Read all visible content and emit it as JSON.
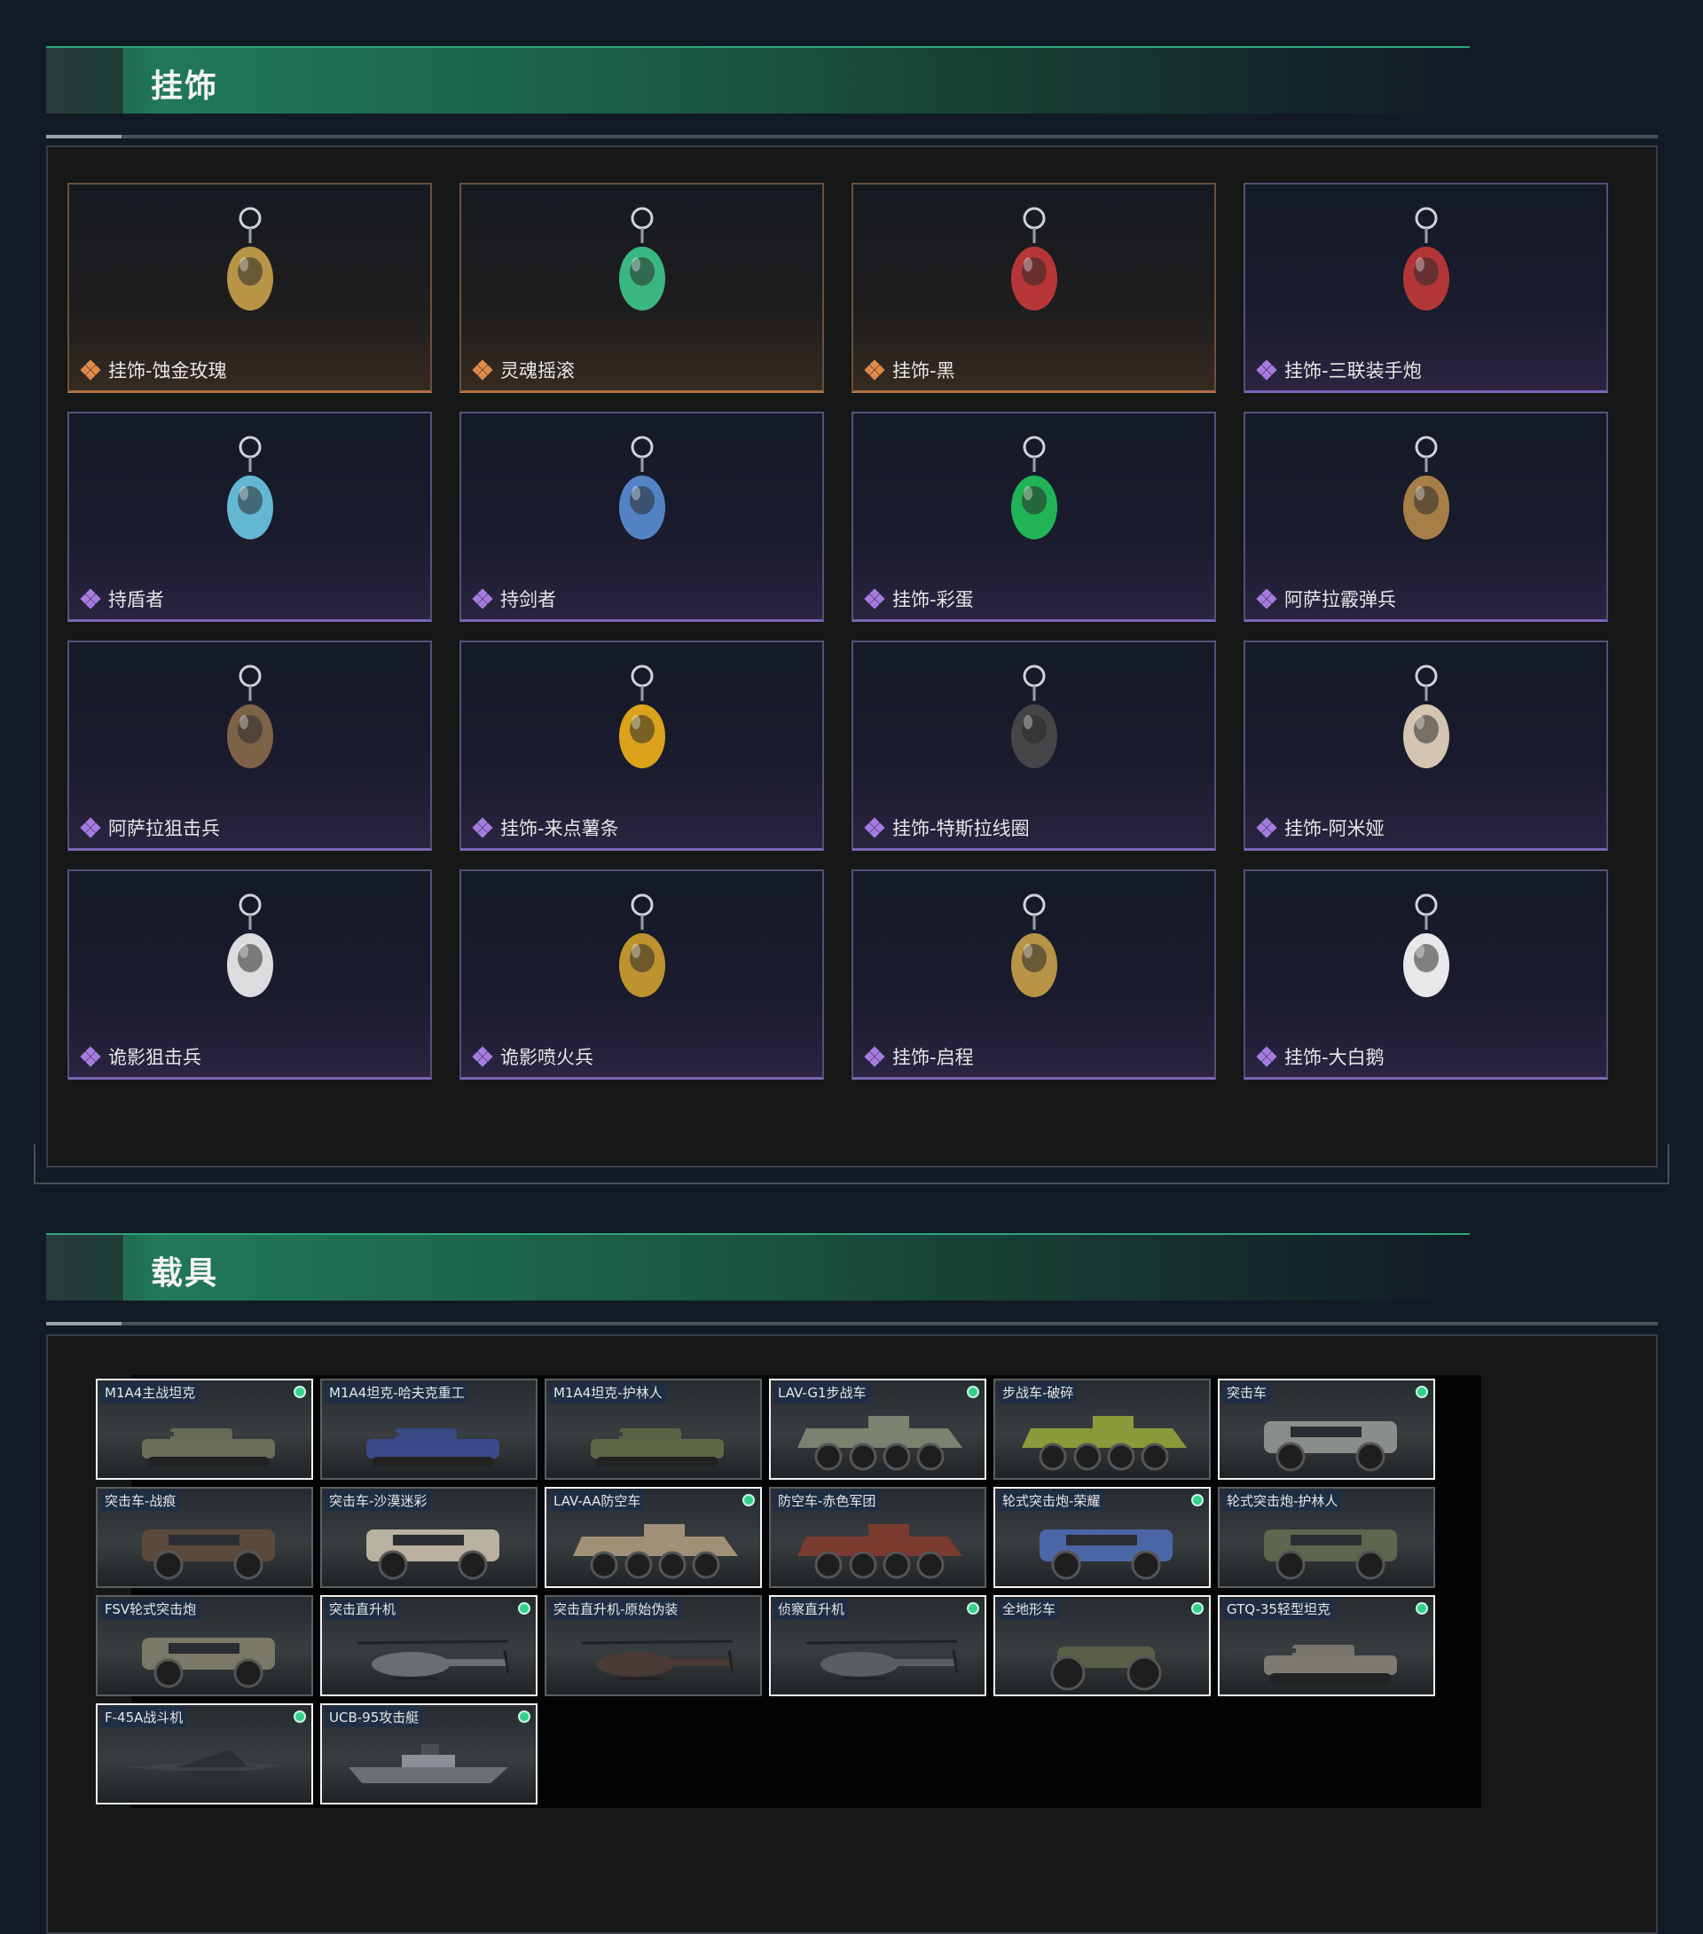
{
  "pendants_section": {
    "title": "挂饰",
    "items": [
      {
        "label": "挂饰-蚀金玫瑰",
        "rarity": "gold",
        "icon": "rose-pendant-icon"
      },
      {
        "label": "灵魂摇滚",
        "rarity": "gold",
        "icon": "guitarist-pendant-icon"
      },
      {
        "label": "挂饰-黑",
        "rarity": "gold",
        "icon": "black-tag-pendant-icon"
      },
      {
        "label": "挂饰-三联装手炮",
        "rarity": "purple",
        "icon": "hand-cannon-pendant-icon"
      },
      {
        "label": "持盾者",
        "rarity": "purple",
        "icon": "shield-knight-pendant-icon"
      },
      {
        "label": "持剑者",
        "rarity": "purple",
        "icon": "sword-knight-pendant-icon"
      },
      {
        "label": "挂饰-彩蛋",
        "rarity": "purple",
        "icon": "egg-pendant-icon"
      },
      {
        "label": "阿萨拉霰弹兵",
        "rarity": "purple",
        "icon": "shotgunner-pendant-icon"
      },
      {
        "label": "阿萨拉狙击兵",
        "rarity": "purple",
        "icon": "sniper-pendant-icon"
      },
      {
        "label": "挂饰-来点薯条",
        "rarity": "purple",
        "icon": "fries-pendant-icon"
      },
      {
        "label": "挂饰-特斯拉线圈",
        "rarity": "purple",
        "icon": "tesla-coil-pendant-icon"
      },
      {
        "label": "挂饰-阿米娅",
        "rarity": "purple",
        "icon": "amiya-pendant-icon"
      },
      {
        "label": "诡影狙击兵",
        "rarity": "purple",
        "icon": "shadow-sniper-pendant-icon"
      },
      {
        "label": "诡影喷火兵",
        "rarity": "purple",
        "icon": "flamethrower-pendant-icon"
      },
      {
        "label": "挂饰-启程",
        "rarity": "purple",
        "icon": "medal-pendant-icon"
      },
      {
        "label": "挂饰-大白鹅",
        "rarity": "purple",
        "icon": "goose-pendant-icon"
      }
    ]
  },
  "vehicles_section": {
    "title": "载具",
    "items": [
      {
        "label": "M1A4主战坦克",
        "owned": true,
        "kind": "tank"
      },
      {
        "label": "M1A4坦克-哈夫克重工",
        "owned": false,
        "kind": "tank"
      },
      {
        "label": "M1A4坦克-护林人",
        "owned": false,
        "kind": "tank"
      },
      {
        "label": "LAV-G1步战车",
        "owned": true,
        "kind": "apc"
      },
      {
        "label": "步战车-破碎",
        "owned": false,
        "kind": "apc"
      },
      {
        "label": "突击车",
        "owned": true,
        "kind": "armored-car"
      },
      {
        "label": "突击车-战痕",
        "owned": false,
        "kind": "armored-car"
      },
      {
        "label": "突击车-沙漠迷彩",
        "owned": false,
        "kind": "armored-car"
      },
      {
        "label": "LAV-AA防空车",
        "owned": true,
        "kind": "apc"
      },
      {
        "label": "防空车-赤色军团",
        "owned": false,
        "kind": "apc"
      },
      {
        "label": "轮式突击炮-荣耀",
        "owned": true,
        "kind": "armored-car"
      },
      {
        "label": "轮式突击炮-护林人",
        "owned": false,
        "kind": "armored-car"
      },
      {
        "label": "FSV轮式突击炮",
        "owned": false,
        "kind": "armored-car"
      },
      {
        "label": "突击直升机",
        "owned": true,
        "kind": "helicopter"
      },
      {
        "label": "突击直升机-原始伪装",
        "owned": false,
        "kind": "helicopter"
      },
      {
        "label": "侦察直升机",
        "owned": true,
        "kind": "helicopter"
      },
      {
        "label": "全地形车",
        "owned": true,
        "kind": "atv"
      },
      {
        "label": "GTQ-35轻型坦克",
        "owned": true,
        "kind": "tank"
      },
      {
        "label": "F-45A战斗机",
        "owned": true,
        "kind": "jet"
      },
      {
        "label": "UCB-95攻击艇",
        "owned": true,
        "kind": "boat"
      }
    ]
  },
  "colors": {
    "header_green": "#21785a",
    "rarity_gold": "#e08a4a",
    "rarity_purple": "#a57be0",
    "owned_dot": "#33d18a"
  }
}
